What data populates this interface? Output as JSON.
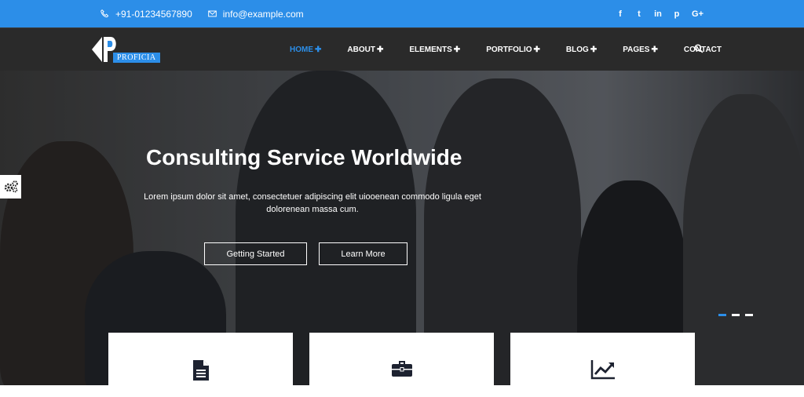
{
  "topbar": {
    "phone": "+91-01234567890",
    "email": "info@example.com",
    "social": [
      "f",
      "t",
      "in",
      "p",
      "G+"
    ]
  },
  "brand": {
    "name": "PROFICIA",
    "color": "#2c8ee8"
  },
  "nav": {
    "items": [
      {
        "label": "HOME",
        "plus": "✚"
      },
      {
        "label": "ABOUT",
        "plus": "✚"
      },
      {
        "label": "ELEMENTS",
        "plus": "✚"
      },
      {
        "label": "PORTFOLIO",
        "plus": "✚"
      },
      {
        "label": "BLOG",
        "plus": "✚"
      },
      {
        "label": "PAGES",
        "plus": "✚"
      },
      {
        "label": "CONTACT",
        "plus": ""
      }
    ],
    "search_icon": "search-icon"
  },
  "hero": {
    "title": "Consulting Service Worldwide",
    "text": "Lorem ipsum dolor sit amet, consectetuer adipiscing elit uiooenean commodo ligula eget dolorenean massa cum.",
    "buttons": {
      "start": "Getting Started",
      "learn": "Learn More"
    },
    "slides_total": 3,
    "active_slide": 1
  },
  "features": {
    "icons": [
      "document-icon",
      "briefcase-icon",
      "chart-icon"
    ]
  }
}
